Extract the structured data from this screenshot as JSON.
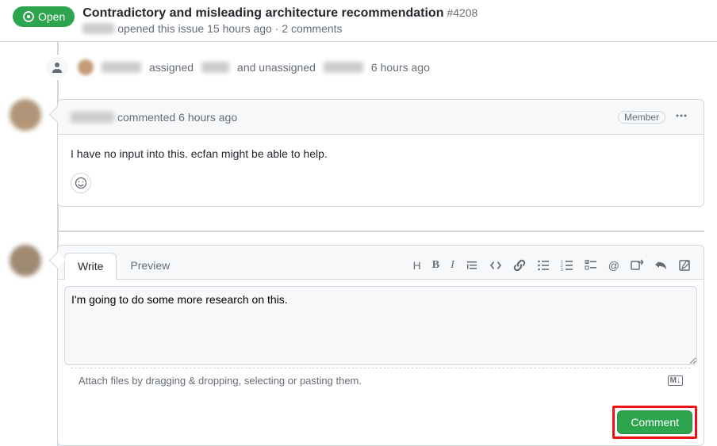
{
  "header": {
    "status": "Open",
    "title": "Contradictory and misleading architecture recommendation",
    "number": "#4208",
    "opened_meta": "opened this issue 15 hours ago · 2 comments"
  },
  "timeline": {
    "assign_event": {
      "text1": "assigned",
      "text2": "and unassigned",
      "time": "6 hours ago"
    }
  },
  "comment": {
    "action": "commented",
    "time": "6 hours ago",
    "badge": "Member",
    "body": "I have no input into this. ecfan might be able to help."
  },
  "compose": {
    "tab_write": "Write",
    "tab_preview": "Preview",
    "textarea_value": "I'm going to do some more research on this.",
    "attach_hint": "Attach files by dragging & dropping, selecting or pasting them.",
    "markdown_label": "M↓",
    "submit_label": "Comment"
  },
  "toolbar_icons": [
    "heading",
    "bold",
    "italic",
    "quote",
    "code",
    "link",
    "ul",
    "ol",
    "tasklist",
    "mention",
    "crossref",
    "reply",
    "saved"
  ]
}
